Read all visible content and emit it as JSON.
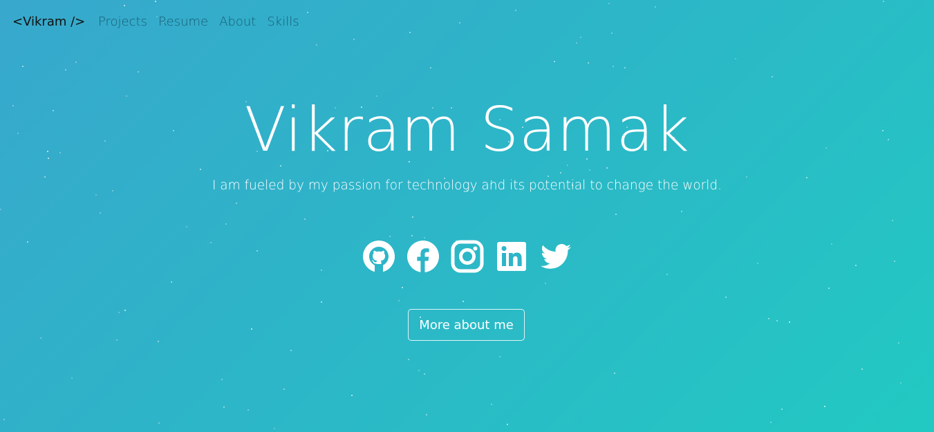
{
  "navbar": {
    "brand": "<Vikram />",
    "links": [
      {
        "label": "Projects"
      },
      {
        "label": "Resume"
      },
      {
        "label": "About"
      },
      {
        "label": "Skills"
      }
    ]
  },
  "hero": {
    "title": "Vikram Samak",
    "subtitle": "I am fueled by my passion for technology and its potential to change the world.",
    "social_icons": [
      "github-icon",
      "facebook-icon",
      "instagram-icon",
      "linkedin-icon",
      "twitter-icon"
    ],
    "cta_label": "More about me"
  },
  "colors": {
    "gradient_start": "#38a8cc",
    "gradient_end": "#22c9c2",
    "text": "#ffffff"
  }
}
